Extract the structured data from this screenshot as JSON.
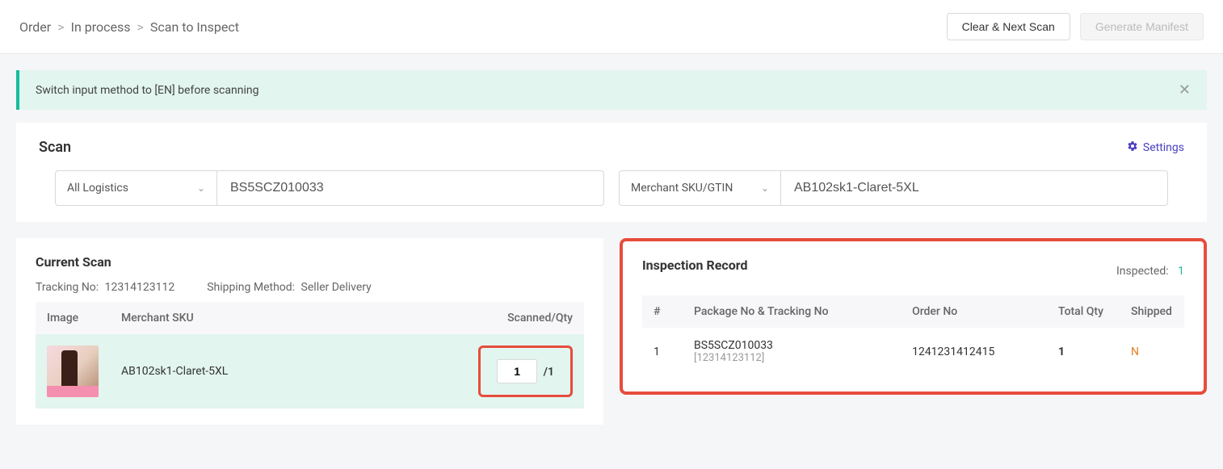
{
  "breadcrumb": {
    "a": "Order",
    "b": "In process",
    "c": "Scan to Inspect"
  },
  "actions": {
    "clear_next": "Clear & Next Scan",
    "manifest": "Generate Manifest"
  },
  "alert": {
    "text": "Switch input method to [EN] before scanning"
  },
  "scan": {
    "title": "Scan",
    "settings": "Settings",
    "logistics_label": "All Logistics",
    "logistics_value": "BS5SCZ010033",
    "sku_label": "Merchant SKU/GTIN",
    "sku_value": "AB102sk1-Claret-5XL"
  },
  "current": {
    "title": "Current Scan",
    "tracking_label": "Tracking No",
    "tracking_value": "12314123112",
    "shipping_label": "Shipping Method",
    "shipping_value": "Seller Delivery",
    "cols": {
      "image": "Image",
      "sku": "Merchant SKU",
      "qty": "Scanned/Qty"
    },
    "row": {
      "sku": "AB102sk1-Claret-5XL",
      "scanned": "1",
      "total": "/1"
    }
  },
  "record": {
    "title": "Inspection Record",
    "inspected_label": "Inspected:",
    "inspected_count": "1",
    "cols": {
      "num": "#",
      "pkg": "Package No & Tracking No",
      "order": "Order No",
      "qty": "Total Qty",
      "shipped": "Shipped"
    },
    "row": {
      "num": "1",
      "pkg": "BS5SCZ010033",
      "tracking": "[12314123112]",
      "order": "1241231412415",
      "qty": "1",
      "shipped": "N"
    }
  }
}
